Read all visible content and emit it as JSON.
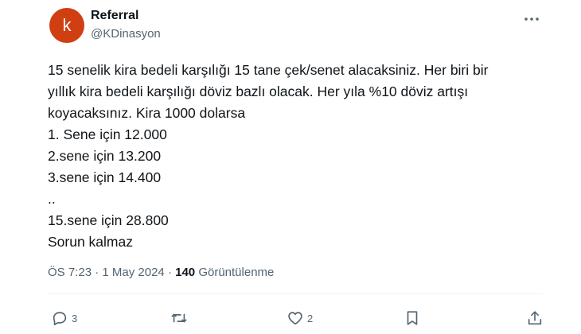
{
  "author": {
    "avatar_letter": "k",
    "avatar_color": "#cf3f12",
    "display_name": "Referral",
    "handle": "@KDinasyon"
  },
  "tweet": {
    "lines": [
      "15 senelik kira bedeli karşılığı 15 tane çek/senet alacaksiniz.  Her biri bir",
      "yıllık kira bedeli karşılığı döviz bazlı olacak.  Her yıla %10 döviz artışı",
      "koyacaksınız. Kira 1000 dolarsa",
      "1. Sene için 12.000",
      "2.sene için 13.200",
      "3.sene için 14.400",
      "..",
      "15.sene için 28.800",
      "Sorun kalmaz"
    ]
  },
  "meta": {
    "time": "ÖS 7:23",
    "date": "1 May 2024",
    "views_count": "140",
    "views_label": "Görüntülenme"
  },
  "actions": {
    "reply_count": "3",
    "like_count": "2"
  },
  "icons": {
    "more": "more-dots-icon",
    "reply": "reply-icon",
    "retweet": "retweet-icon",
    "like": "heart-icon",
    "bookmark": "bookmark-icon",
    "share": "share-icon"
  }
}
